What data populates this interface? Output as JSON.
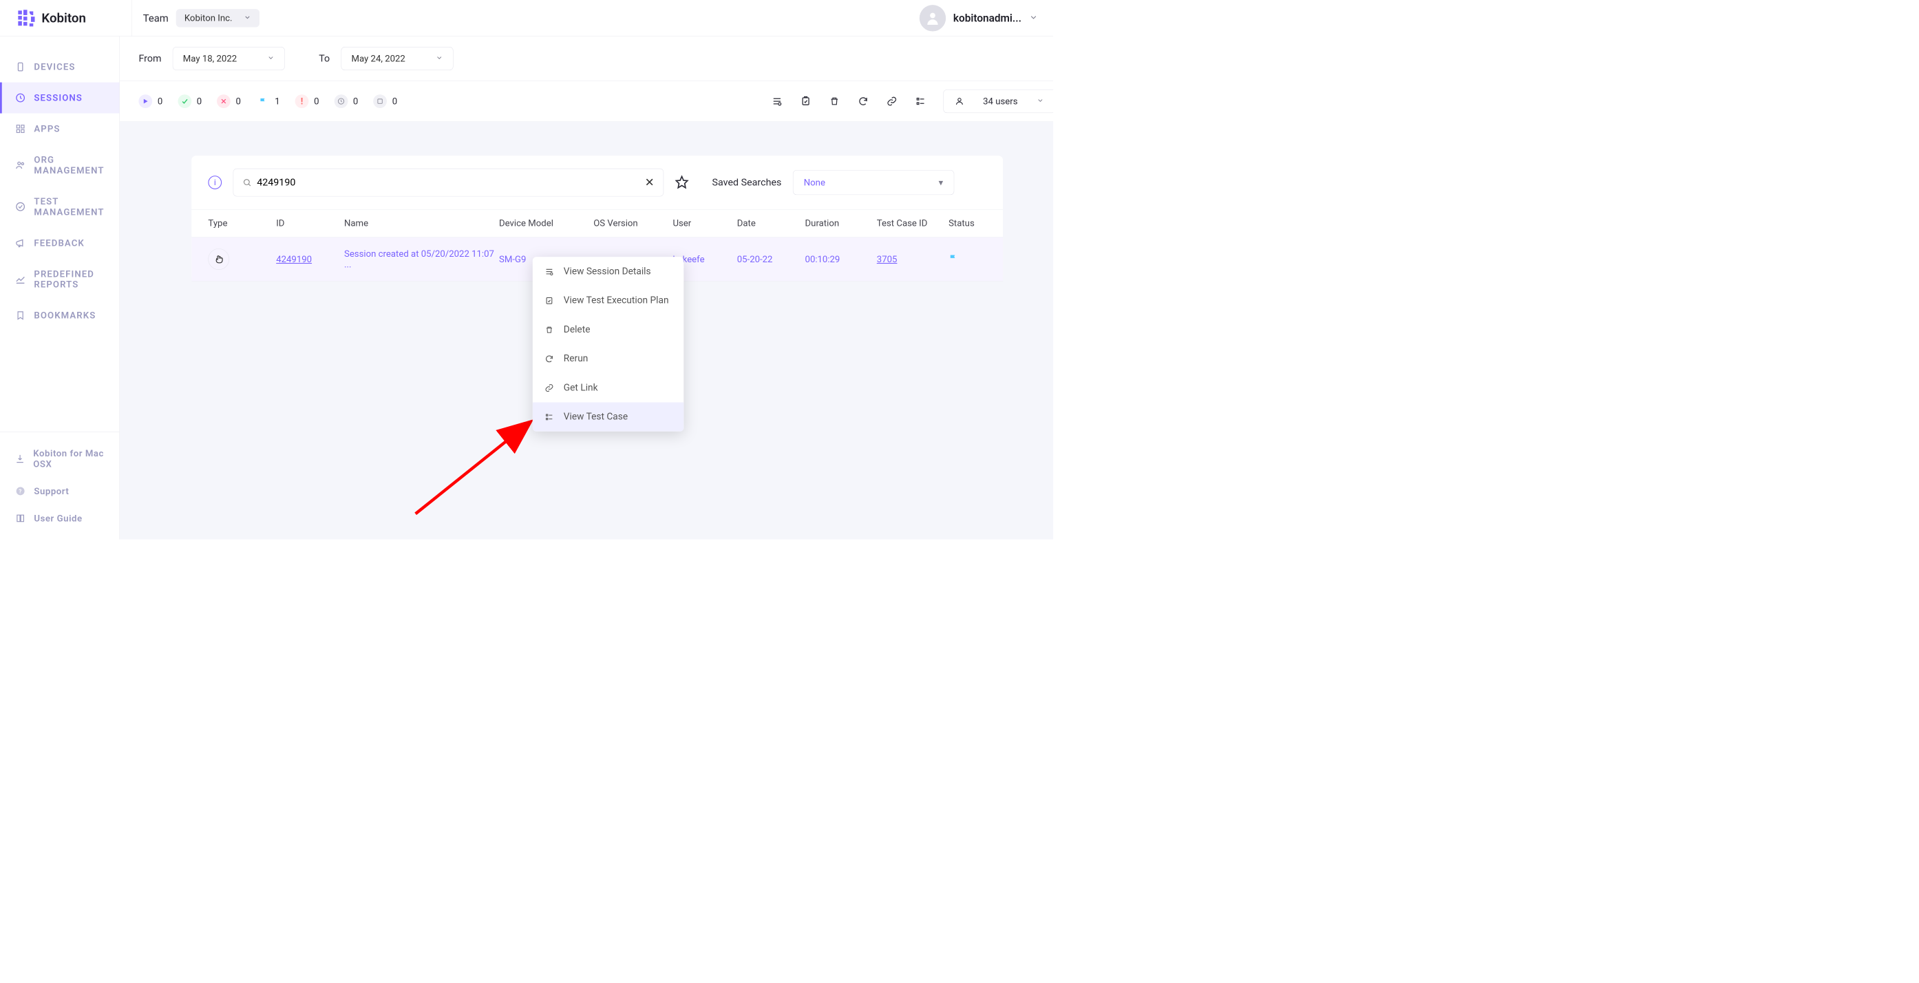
{
  "brand": {
    "name": "Kobiton"
  },
  "team": {
    "label": "Team",
    "selected": "Kobiton Inc."
  },
  "user": {
    "name": "kobitonadmi..."
  },
  "sidebar": {
    "items": [
      {
        "label": "DEVICES"
      },
      {
        "label": "SESSIONS"
      },
      {
        "label": "APPS"
      },
      {
        "label": "ORG MANAGEMENT"
      },
      {
        "label": "TEST MANAGEMENT"
      },
      {
        "label": "FEEDBACK"
      },
      {
        "label": "PREDEFINED REPORTS"
      },
      {
        "label": "BOOKMARKS"
      }
    ],
    "bottom": [
      {
        "label": "Kobiton for Mac OSX"
      },
      {
        "label": "Support"
      },
      {
        "label": "User Guide"
      }
    ]
  },
  "filters": {
    "from_label": "From",
    "from_value": "May 18, 2022",
    "to_label": "To",
    "to_value": "May 24, 2022"
  },
  "stats": {
    "play": "0",
    "check": "0",
    "x": "0",
    "flag": "1",
    "bang": "0",
    "clock": "0",
    "stop": "0"
  },
  "users_select": "34 users",
  "search": {
    "value": "4249190",
    "saved_label": "Saved Searches",
    "saved_value": "None"
  },
  "columns": [
    "Type",
    "ID",
    "Name",
    "Device Model",
    "OS Version",
    "User",
    "Date",
    "Duration",
    "Test Case ID",
    "Status"
  ],
  "row": {
    "id": "4249190",
    "name": "Session created at 05/20/2022 11:07 ...",
    "device": "SM-G9",
    "os": "",
    "user": "kokeefe",
    "date": "05-20-22",
    "duration": "00:10:29",
    "testcase": "3705"
  },
  "context": [
    "View Session Details",
    "View Test Execution Plan",
    "Delete",
    "Rerun",
    "Get Link",
    "View Test Case"
  ]
}
